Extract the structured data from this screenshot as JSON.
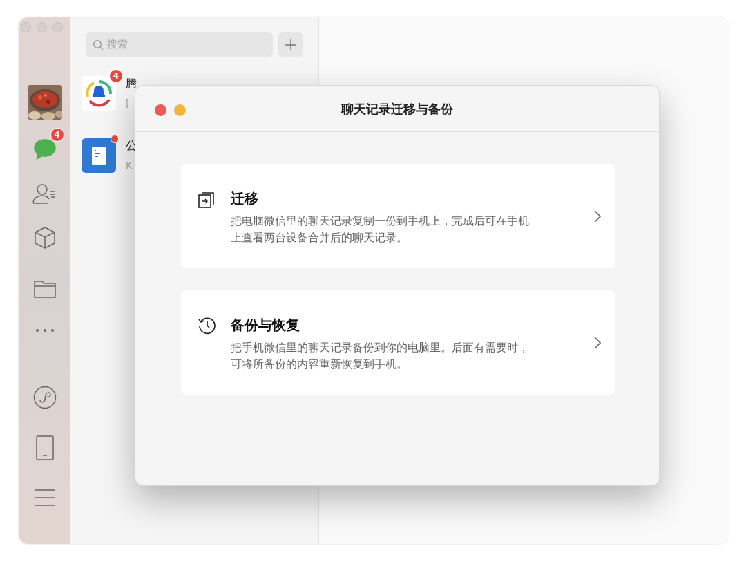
{
  "window": {
    "controls": [
      {
        "active": false
      },
      {
        "active": false
      },
      {
        "active": false
      }
    ]
  },
  "sidebar": {
    "items": [
      {
        "kind": "avatar"
      },
      {
        "kind": "chats",
        "selected": true,
        "badge": "4"
      },
      {
        "kind": "contacts",
        "selected": false
      },
      {
        "kind": "box",
        "selected": false
      },
      {
        "kind": "folder",
        "selected": false
      },
      {
        "kind": "more",
        "selected": false
      },
      {
        "kind": "miniprogram",
        "selected": false
      },
      {
        "kind": "phone",
        "selected": false
      },
      {
        "kind": "menu",
        "selected": false
      }
    ]
  },
  "search": {
    "placeholder": "搜索"
  },
  "conversations": [
    {
      "kind": "qq",
      "name": "腾",
      "preview": "[",
      "badge": "4"
    },
    {
      "kind": "doc",
      "name": "公",
      "preview": "K",
      "unread_dot": true
    }
  ],
  "dialog": {
    "title": "聊天记录迁移与备份",
    "controls": [
      {
        "kind": "close",
        "active": true
      },
      {
        "kind": "minimize",
        "active": true
      }
    ],
    "options": [
      {
        "kind": "migrate",
        "title": "迁移",
        "description": "把电脑微信里的聊天记录复制一份到手机上，完成后可在手机上查看两台设备合并后的聊天记录。"
      },
      {
        "kind": "backup",
        "title": "备份与恢复",
        "description": "把手机微信里的聊天记录备份到你的电脑里。后面有需要时，可将所备份的内容重新恢复到手机。"
      }
    ]
  }
}
